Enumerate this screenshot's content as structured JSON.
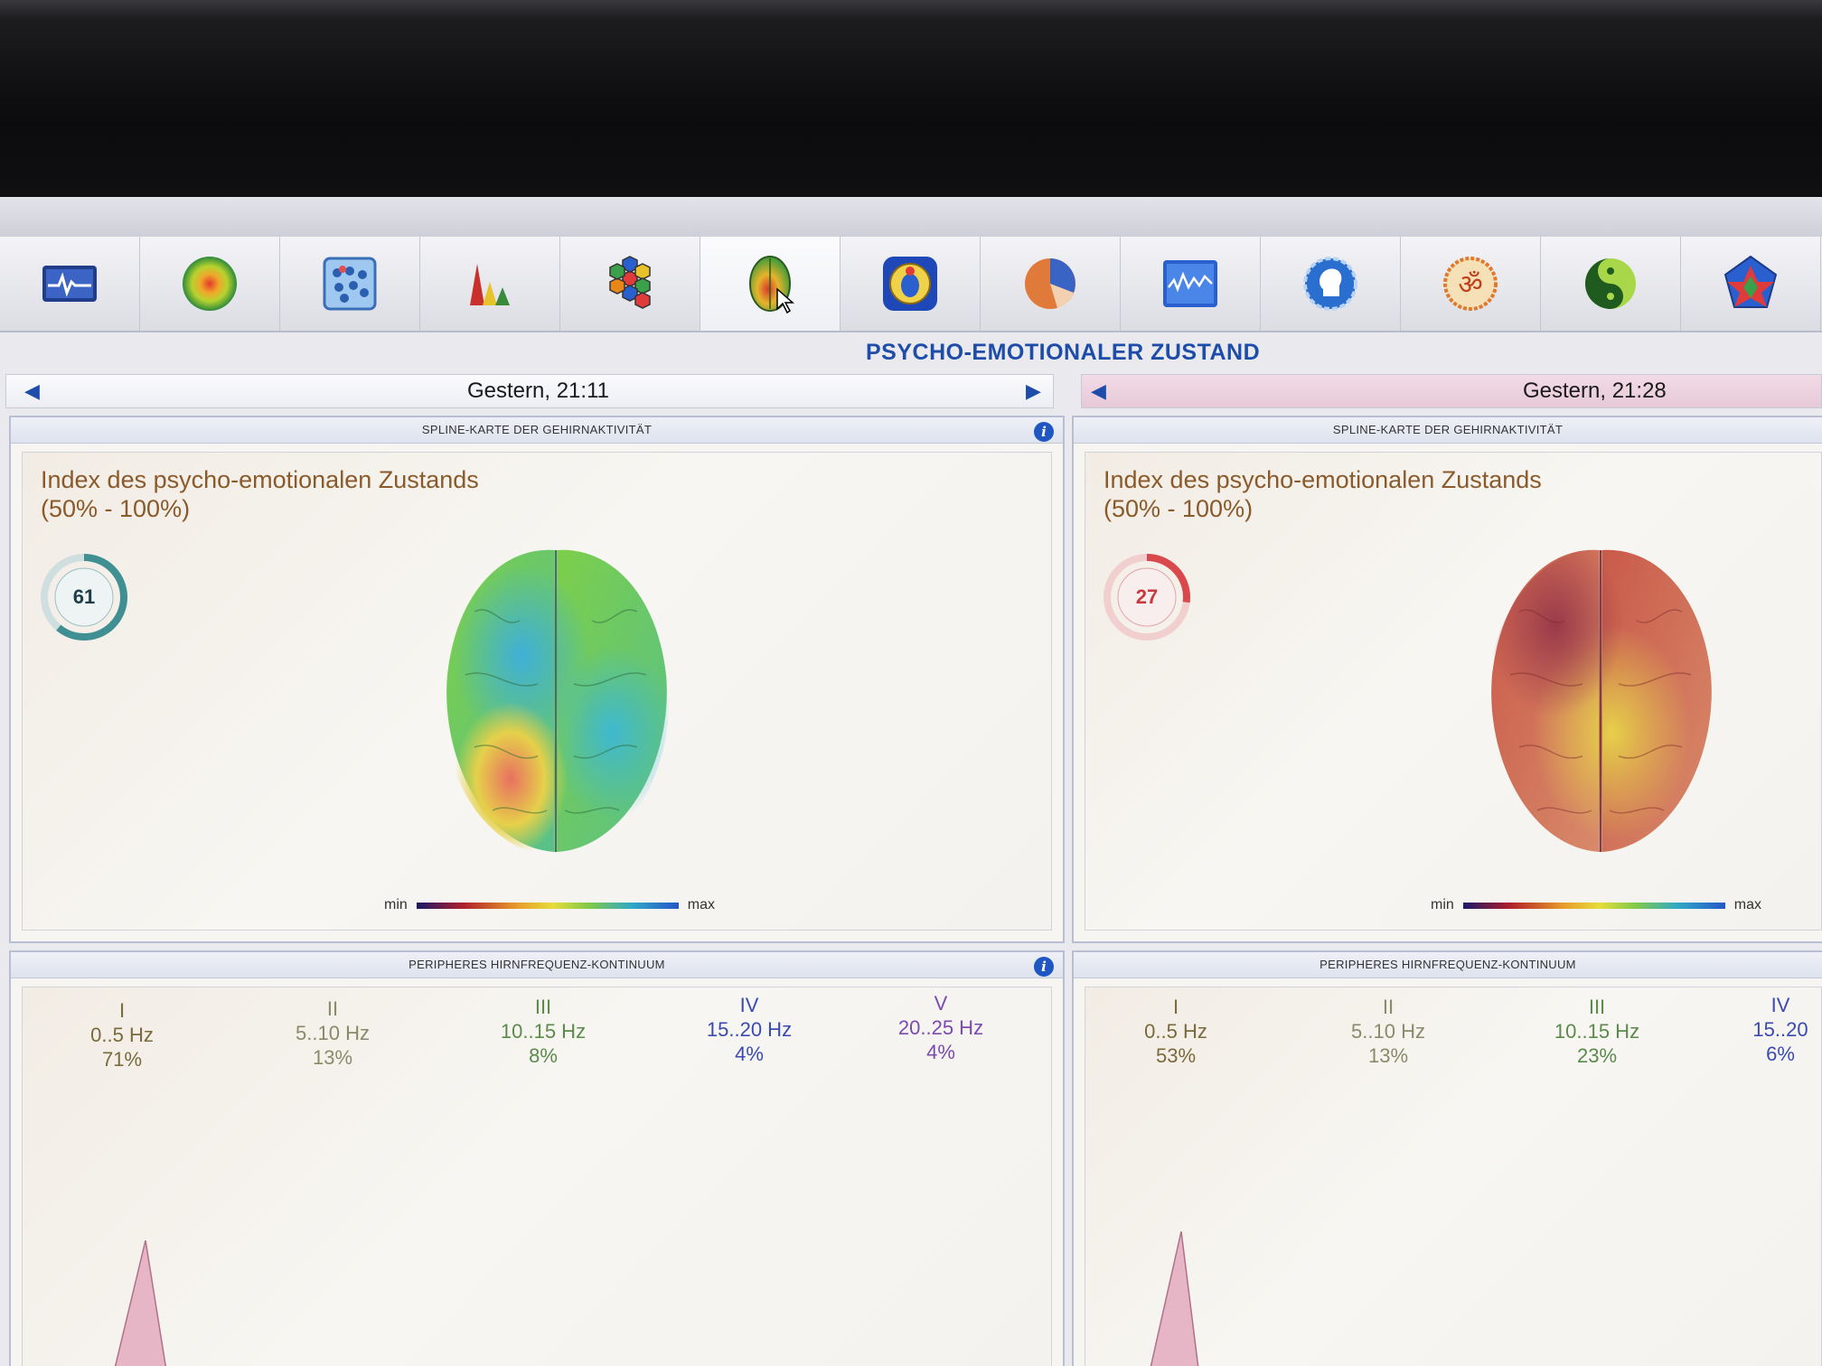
{
  "toolbar": {
    "tools": [
      {
        "name": "heartbeat-monitor-icon"
      },
      {
        "name": "radial-heatmap-icon"
      },
      {
        "name": "cell-grid-icon"
      },
      {
        "name": "peaks-chart-icon"
      },
      {
        "name": "hexagon-cluster-icon"
      },
      {
        "name": "brain-map-icon",
        "active": true
      },
      {
        "name": "scarab-shield-icon"
      },
      {
        "name": "pie-chart-icon"
      },
      {
        "name": "wave-chart-icon"
      },
      {
        "name": "head-profile-icon"
      },
      {
        "name": "om-symbol-icon"
      },
      {
        "name": "yin-yang-icon"
      },
      {
        "name": "pentagon-star-icon"
      }
    ]
  },
  "page": {
    "title": "PSYCHO-EMOTIONALER ZUSTAND"
  },
  "sessions": {
    "left": {
      "date": "Gestern, 21:11",
      "spline_title": "SPLINE-KARTE DER GEHIRNAKTIVITÄT",
      "index_line1": "Index des psycho-emotionalen Zustands",
      "index_line2": "(50% - 100%)",
      "gauge_value": "61",
      "gauge_fraction": 0.61,
      "gauge_color": "#3f8f93",
      "legend_min": "min",
      "legend_max": "max",
      "freq_title": "PERIPHERES HIRNFREQUENZ-KONTINUUM",
      "bands": [
        {
          "roman": "I",
          "range": "0..5 Hz",
          "pct": "71%"
        },
        {
          "roman": "II",
          "range": "5..10 Hz",
          "pct": "13%"
        },
        {
          "roman": "III",
          "range": "10..15 Hz",
          "pct": "8%"
        },
        {
          "roman": "IV",
          "range": "15..20 Hz",
          "pct": "4%"
        },
        {
          "roman": "V",
          "range": "20..25 Hz",
          "pct": "4%"
        }
      ]
    },
    "right": {
      "date": "Gestern, 21:28",
      "spline_title": "SPLINE-KARTE DER GEHIRNAKTIVITÄT",
      "index_line1": "Index des psycho-emotionalen Zustands",
      "index_line2": "(50% - 100%)",
      "gauge_value": "27",
      "gauge_fraction": 0.27,
      "gauge_color": "#d9484d",
      "legend_min": "min",
      "legend_max": "max",
      "freq_title": "PERIPHERES HIRNFREQUENZ-KONTINUUM",
      "bands": [
        {
          "roman": "I",
          "range": "0..5 Hz",
          "pct": "53%"
        },
        {
          "roman": "II",
          "range": "5..10 Hz",
          "pct": "13%"
        },
        {
          "roman": "III",
          "range": "10..15 Hz",
          "pct": "23%"
        },
        {
          "roman": "IV",
          "range": "15..20",
          "pct": "6%"
        }
      ]
    }
  },
  "colors": {
    "band_I": "#7a6a3a",
    "band_II": "#7d8a5a",
    "band_III": "#5b8a4a",
    "band_IV": "#3a4ab0",
    "band_V": "#7a4ab0",
    "accent": "#1d4da8"
  }
}
